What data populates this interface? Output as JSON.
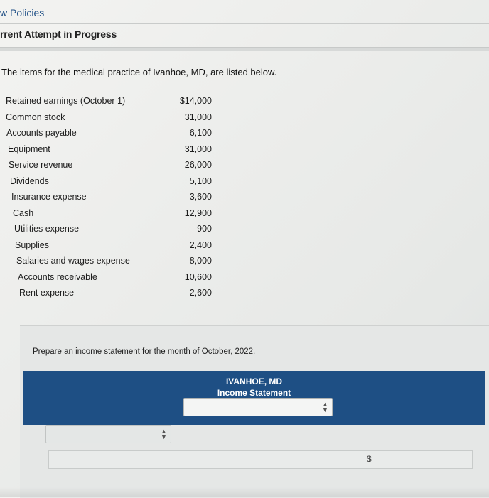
{
  "header": {
    "policies_link": "w Policies",
    "attempt_status": "rrent Attempt in Progress"
  },
  "question": {
    "intro": "The items for the medical practice of Ivanhoe, MD, are listed below.",
    "items": [
      {
        "label": "Retained earnings (October 1)",
        "value": "$14,000"
      },
      {
        "label": "Common stock",
        "value": "31,000"
      },
      {
        "label": "Accounts payable",
        "value": "6,100"
      },
      {
        "label": "Equipment",
        "value": "31,000"
      },
      {
        "label": "Service revenue",
        "value": "26,000"
      },
      {
        "label": "Dividends",
        "value": "5,100"
      },
      {
        "label": "Insurance expense",
        "value": "3,600"
      },
      {
        "label": "Cash",
        "value": "12,900"
      },
      {
        "label": "Utilities expense",
        "value": "900"
      },
      {
        "label": "Supplies",
        "value": "2,400"
      },
      {
        "label": "Salaries and wages expense",
        "value": "8,000"
      },
      {
        "label": "Accounts receivable",
        "value": "10,600"
      },
      {
        "label": "Rent expense",
        "value": "2,600"
      }
    ],
    "prompt": "Prepare an income statement for the month of October, 2022."
  },
  "statement": {
    "company": "IVANHOE, MD",
    "title": "Income Statement",
    "period_select_value": "",
    "account_select_value": "",
    "amount_value": "",
    "currency_symbol": "$"
  },
  "colors": {
    "link": "#1f4f86",
    "header_band": "#1e4f84"
  }
}
